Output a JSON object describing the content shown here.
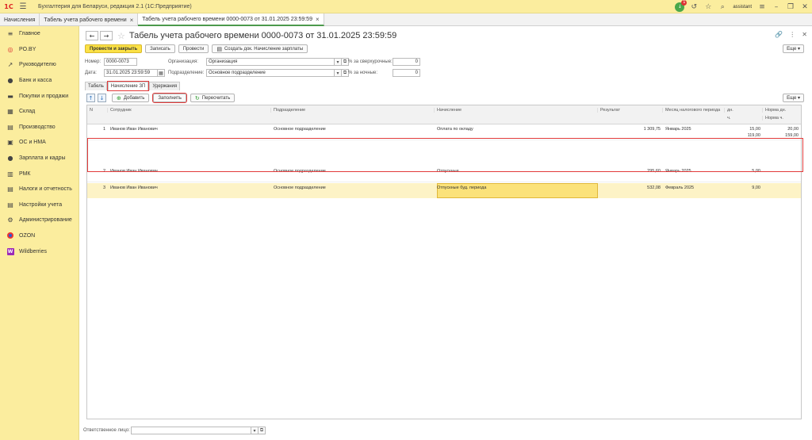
{
  "app": {
    "logo": "1С",
    "title": "Бухгалтерия для Беларуси, редакция 2.1  (1С:Предприятие)",
    "user": "assistant",
    "notification_count": "1"
  },
  "window_tabs": [
    {
      "label": "Начисления"
    },
    {
      "label": "Табель учета рабочего времени"
    },
    {
      "label": "Табель учета рабочего времени 0000-0073 от 31.01.2025 23:59:59"
    }
  ],
  "sidebar": {
    "items": [
      {
        "label": "Главное",
        "icon": "≡"
      },
      {
        "label": "PO.BY",
        "icon": "◎"
      },
      {
        "label": "Руководителю",
        "icon": "↗"
      },
      {
        "label": "Банк и касса",
        "icon": "●"
      },
      {
        "label": "Покупки и продажи",
        "icon": "▬"
      },
      {
        "label": "Склад",
        "icon": "▦"
      },
      {
        "label": "Производство",
        "icon": "▤"
      },
      {
        "label": "ОС и НМА",
        "icon": "▣"
      },
      {
        "label": "Зарплата и кадры",
        "icon": "●"
      },
      {
        "label": "РМК",
        "icon": "▥"
      },
      {
        "label": "Налоги и отчетность",
        "icon": "▤"
      },
      {
        "label": "Настройки учета",
        "icon": "▤"
      },
      {
        "label": "Администрирование",
        "icon": "⚙"
      },
      {
        "label": "OZON",
        "icon": ""
      },
      {
        "label": "Wildberries",
        "icon": "W"
      }
    ]
  },
  "document": {
    "title": "Табель учета рабочего времени 0000-0073 от 31.01.2025 23:59:59",
    "more_label": "Еще",
    "toolbar": {
      "post_close": "Провести и закрыть",
      "save": "Записать",
      "post": "Провести",
      "create_doc": "Создать док. Начисление зарплаты"
    },
    "fields": {
      "number_label": "Номер:",
      "number_value": "0000-0073",
      "date_label": "Дата:",
      "date_value": "31.01.2025 23:59:59",
      "org_label": "Организация:",
      "org_value": "Организация",
      "dept_label": "Подразделение:",
      "dept_value": "Основное подразделение",
      "overtime_label": "% за сверхурочные:",
      "overtime_value": "0",
      "night_label": "% за ночные:",
      "night_value": "0"
    },
    "subtabs": [
      {
        "label": "Табель"
      },
      {
        "label": "Начисление ЗП"
      },
      {
        "label": "Удержания"
      }
    ],
    "grid_toolbar": {
      "up": "↑",
      "down": "↓",
      "add": "Добавить",
      "fill": "Заполнить",
      "recalc": "Пересчитать",
      "more": "Еще"
    },
    "columns": {
      "n": "N",
      "employee": "Сотрудник",
      "department": "Подразделение",
      "accrual": "Начисление",
      "result": "Результат",
      "tax_month": "Месяц налогового периода",
      "days": "дн.",
      "hours": "ч.",
      "norm_days": "Норма дн.",
      "norm_hours": "Норма ч."
    },
    "rows": [
      {
        "n": "1",
        "employee": "Иванов Иван Иванович",
        "department": "Основное подразделение",
        "accrual": "Оплата по окладу",
        "result": "1 309,75",
        "tax_month": "Январь 2025",
        "days": "15,00",
        "hours": "119,00",
        "norm_days": "20,00",
        "norm_hours": "159,00"
      },
      {
        "n": "2",
        "employee": "Иванов Иван Иванович",
        "department": "Основное подразделение",
        "accrual": "Отпускные",
        "result": "295,60",
        "tax_month": "Январь 2025",
        "days": "5,00",
        "hours": "",
        "norm_days": "",
        "norm_hours": ""
      },
      {
        "n": "3",
        "employee": "Иванов Иван Иванович",
        "department": "Основное подразделение",
        "accrual": "Отпускные буд. периода",
        "result": "532,08",
        "tax_month": "Февраль 2025",
        "days": "9,00",
        "hours": "",
        "norm_days": "",
        "norm_hours": ""
      }
    ],
    "footer": {
      "responsible_label": "Ответственное лицо:",
      "responsible_value": ""
    }
  },
  "colors": {
    "accent_yellow": "#fbe146",
    "sidebar_bg": "#fbed9e",
    "highlight_red": "#e23a3a",
    "selected_row": "#fdf3c6",
    "active_cell": "#fbe27a"
  }
}
